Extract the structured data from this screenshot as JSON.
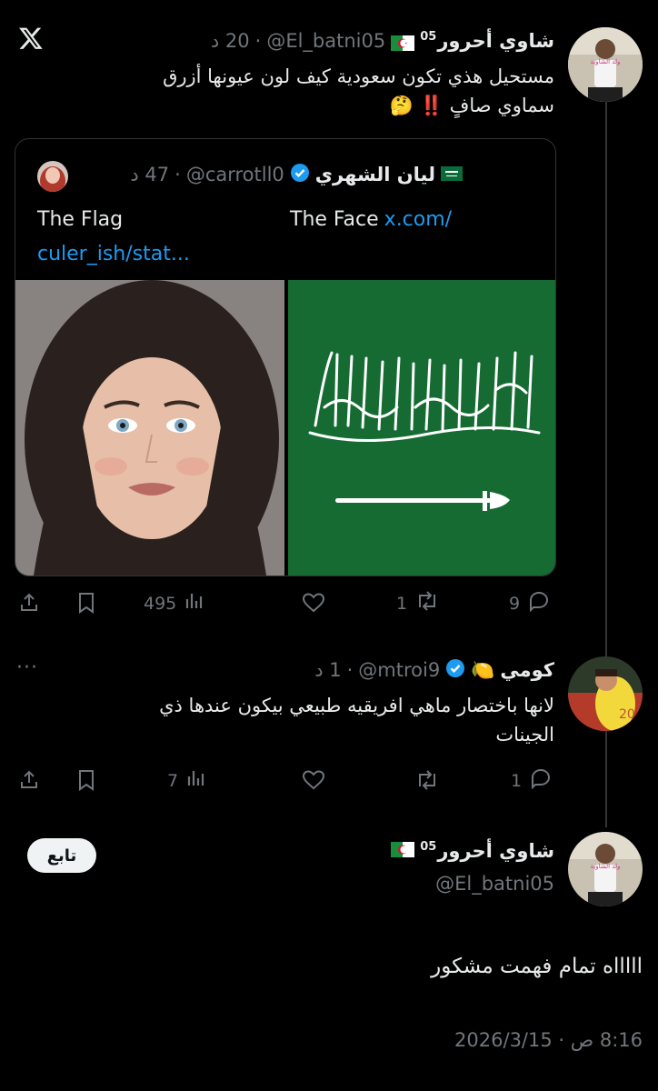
{
  "app": {
    "logo": "x-logo-icon"
  },
  "tweet1": {
    "name": "شاوي أحرور",
    "name_sup": "05",
    "flag": "flag-algeria",
    "handle": "@El_batni05",
    "time": "20 د",
    "separator": "·",
    "text_line1": "مستحيل هذي تكون سعودية كيف لون عيونها أزرق",
    "text_line2": "سماوي صافٍ",
    "emoji_bang": "‼️",
    "emoji_thinking": "🤔",
    "quote": {
      "name": "ليان الشهري",
      "flag": "flag-saudi",
      "handle": "@carrotll0",
      "time": "47 د",
      "text_left": "The Flag",
      "text_right": "The Face",
      "link_part1": "x.com/",
      "link_part2": "culer_ish/stat..."
    },
    "actions": {
      "views": "495",
      "retweets": "1",
      "replies": "9"
    }
  },
  "tweet2": {
    "name": "كومي",
    "emoji": "🍋",
    "handle": "@mtroi9",
    "time": "1 د",
    "separator": "·",
    "more": "···",
    "text_line1": "لانها باختصار ماهي افريقيه طبيعي بيكون عندها ذي",
    "text_line2": "الجينات",
    "actions": {
      "views": "7",
      "replies": "1"
    }
  },
  "main": {
    "name": "شاوي أحرور",
    "name_sup": "05",
    "flag": "flag-algeria",
    "handle": "@El_batni05",
    "follow_label": "تابع",
    "text": "اااااه تمام فهمت مشكور",
    "timestamp": "8:16 ص · 2026/3/15"
  },
  "colors": {
    "accent": "#1d9bf0",
    "muted": "#71767b",
    "text": "#e7e9ea",
    "background": "#000000"
  }
}
